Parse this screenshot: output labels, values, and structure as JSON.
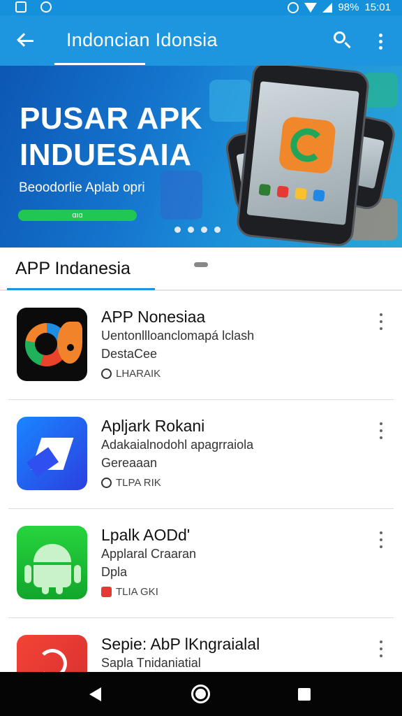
{
  "status_bar": {
    "battery": "98%",
    "time": "15:01",
    "icons": [
      "notification-icon",
      "sync-icon",
      "alarm-icon",
      "wifi-icon",
      "signal-icon",
      "battery-icon"
    ]
  },
  "toolbar": {
    "title": "Indoncian Idonsia",
    "back_icon": "arrow-left-icon",
    "search_icon": "search-icon",
    "menu_icon": "more-vert-icon",
    "color": "#1e96df"
  },
  "banner": {
    "title_line1": "PUSAR APK",
    "title_line2": "INDUESAIA",
    "subtitle": "Beoodorlie Aplab opri",
    "button_label": "ɑıɑ",
    "accent": "#20c853",
    "pages": 4
  },
  "tabs": {
    "active_label": "APP Indanesia"
  },
  "apps": [
    {
      "name": "APP Nonesiaa",
      "description": "Uentonllloanclomapá lclash",
      "developer": "DestaCee",
      "badge": "LHARAIK",
      "icon": "fish-logo-icon",
      "badge_icon": "check-circle-icon"
    },
    {
      "name": "Apljark Rokani",
      "description": "Adakaialnodohl apagrraiola",
      "developer": "Gereaaan",
      "badge": "TLPA RIK",
      "icon": "blue-arrow-logo-icon",
      "badge_icon": "check-circle-icon"
    },
    {
      "name": "Lpalk AODd'",
      "description": "Applaral Craaran",
      "developer": "Dpla",
      "badge": "TLIA GKI",
      "icon": "android-logo-icon",
      "badge_icon": "shield-icon"
    },
    {
      "name": "Sepie: AbP lKngraialal",
      "description": "Sapla Tnidaniatial",
      "developer": "",
      "badge": "",
      "icon": "red-logo-icon",
      "badge_icon": ""
    }
  ],
  "navbar": {
    "back_icon": "nav-back-icon",
    "home_icon": "nav-home-icon",
    "recents_icon": "nav-recents-icon"
  }
}
